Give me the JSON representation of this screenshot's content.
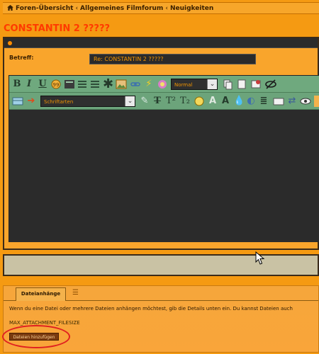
{
  "breadcrumb": {
    "items": [
      "Foren-Übersicht",
      "Allgemeines Filmforum",
      "Neuigkeiten"
    ],
    "separator": "‹"
  },
  "page": {
    "title": "CONSTANTIN 2 ?????"
  },
  "form": {
    "subject_label": "Betreff:",
    "subject_value": "Re: CONSTANTIN 2 ?????"
  },
  "toolbar": {
    "row1": [
      "bold",
      "italic",
      "underline",
      "quote",
      "code",
      "list-bullet",
      "list-numbered",
      "list-item",
      "image",
      "link",
      "flash",
      "color",
      "font-size",
      "copy",
      "paste",
      "spoiler",
      "hide"
    ],
    "font_size_value": "Normal",
    "font_family_value": "Schriftarten",
    "labels": {
      "bold": "B",
      "italic": "I",
      "underline": "U",
      "sup": "T²",
      "sub": "T₂",
      "font_a": "A",
      "font_a2": "A"
    }
  },
  "attachments": {
    "tab_label": "Dateianhänge",
    "description": "Wenn du eine Datei oder mehrere Dateien anhängen möchtest, gib die Details unten ein. Du kannst Dateien auch",
    "max_size": "MAX_ATTACHMENT_FILESIZE",
    "add_button": "Dateien hinzufügen"
  },
  "colors": {
    "accent": "#f59a12",
    "title": "#ff3a00",
    "toolbar": "#6fa97e",
    "input_bg": "#2a2a2a",
    "annotation": "#e02020"
  }
}
